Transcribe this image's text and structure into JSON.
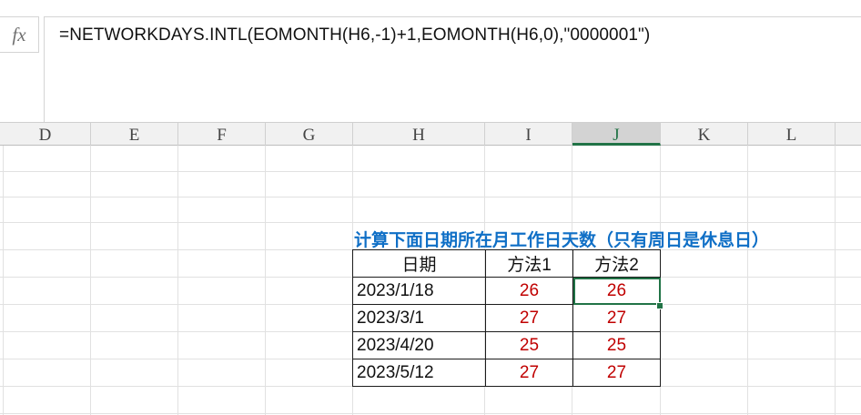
{
  "formula_bar": {
    "fx_label": "fx",
    "formula": "=NETWORKDAYS.INTL(EOMONTH(H6,-1)+1,EOMONTH(H6,0),\"0000001\")"
  },
  "columns": [
    "D",
    "E",
    "F",
    "G",
    "H",
    "I",
    "J",
    "K",
    "L"
  ],
  "active_column": "J",
  "table": {
    "title": "计算下面日期所在月工作日天数（只有周日是休息日）",
    "headers": [
      "日期",
      "方法1",
      "方法2"
    ],
    "rows": [
      {
        "date": "2023/1/18",
        "m1": "26",
        "m2": "26"
      },
      {
        "date": "2023/3/1",
        "m1": "27",
        "m2": "27"
      },
      {
        "date": "2023/4/20",
        "m1": "25",
        "m2": "25"
      },
      {
        "date": "2023/5/12",
        "m1": "27",
        "m2": "27"
      }
    ]
  },
  "colors": {
    "title": "#0f6fc6",
    "values": "#c00000",
    "selection": "#217346"
  }
}
